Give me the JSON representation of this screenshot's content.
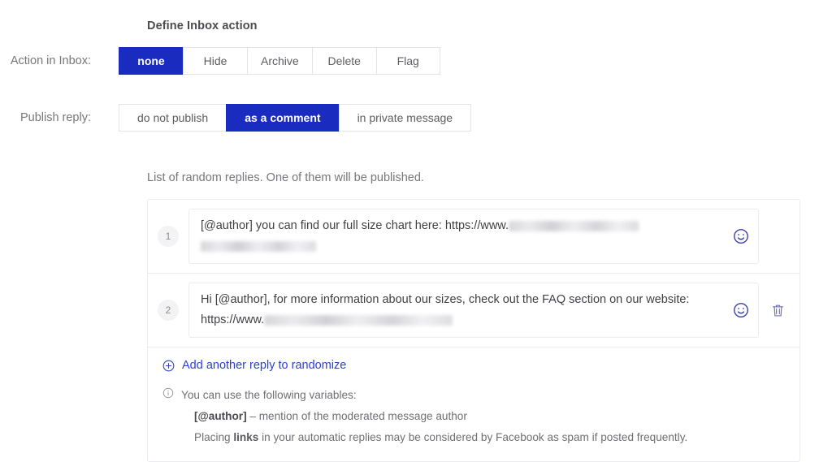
{
  "section": {
    "title": "Define Inbox action"
  },
  "rows": {
    "action_in_inbox": {
      "label": "Action in Inbox:",
      "options": [
        "none",
        "Hide",
        "Archive",
        "Delete",
        "Flag"
      ],
      "selected": "none"
    },
    "publish_reply": {
      "label": "Publish reply:",
      "options": [
        "do not publish",
        "as a comment",
        "in private message"
      ],
      "selected": "as a comment"
    }
  },
  "replies_panel": {
    "caption": "List of random replies. One of them will be published.",
    "items": [
      {
        "index": "1",
        "text_before": "[@author] you can find our full size chart here: https://www.",
        "redacted_widths": [
          160,
          142
        ],
        "emoji_icon": "smiley-icon",
        "has_delete": false
      },
      {
        "index": "2",
        "text_before": "Hi [@author], for more information about our sizes, check out the FAQ section on our website: https://www.",
        "redacted_widths": [
          232
        ],
        "emoji_icon": "smiley-icon",
        "has_delete": true,
        "delete_icon": "trash-icon"
      }
    ],
    "add_link": {
      "icon": "plus-circle-icon",
      "label": "Add another reply to randomize"
    },
    "hint": {
      "icon": "info-circle-icon",
      "heading": "You can use the following variables:",
      "variable_name": "[@author]",
      "variable_desc": " – mention of the moderated message author",
      "spam_prefix": "Placing ",
      "spam_bold": "links",
      "spam_suffix": " in your automatic replies may be considered by Facebook as spam if posted frequently."
    }
  },
  "colors": {
    "accent_blue": "#1a2bc0",
    "link_blue": "#2b3fd0",
    "border_gray": "#ececf0",
    "label_gray": "#76767b"
  }
}
